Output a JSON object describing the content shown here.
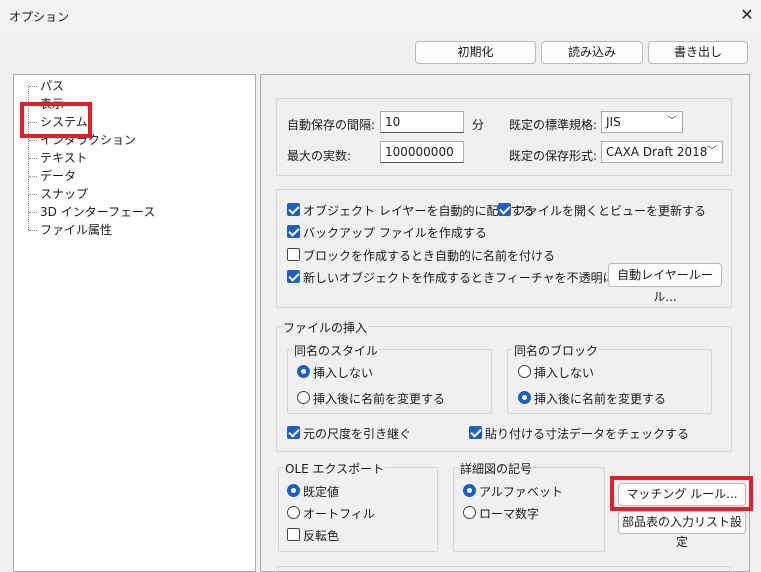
{
  "window": {
    "title": "オプション"
  },
  "toolbar": {
    "reset_label": "初期化",
    "load_label": "読み込み",
    "export_label": "書き出し"
  },
  "tree": {
    "items": [
      {
        "label": "パス"
      },
      {
        "label": "表示"
      },
      {
        "label": "システム"
      },
      {
        "label": "インタラクション"
      },
      {
        "label": "テキスト"
      },
      {
        "label": "データ"
      },
      {
        "label": "スナップ"
      },
      {
        "label": "3D インターフェース"
      },
      {
        "label": "ファイル属性"
      }
    ]
  },
  "autosave": {
    "interval_label": "自動保存の間隔:",
    "interval_value": "10",
    "interval_unit": "分",
    "standard_label": "既定の標準規格:",
    "standard_value": "JIS",
    "max_label": "最大の実数:",
    "max_value": "100000000",
    "format_label": "既定の保存形式:",
    "format_value": "CAXA Draft 2018"
  },
  "options": {
    "auto_layer_label": "オブジェクト レイヤーを自動的に配置する",
    "refresh_view_label": "ファイルを開くとビューを更新する",
    "backup_label": "バックアップ ファイルを作成する",
    "auto_name_label": "ブロックを作成するとき自動的に名前を付ける",
    "opaque_label": "新しいオブジェクトを作成するときフィーチャを不透明に設定する",
    "auto_layer_rule_label": "自動レイヤールール..."
  },
  "insert": {
    "title": "ファイルの挿入",
    "style_group": "同名のスタイル",
    "style_no_insert": "挿入しない",
    "style_rename": "挿入後に名前を変更する",
    "block_group": "同名のブロック",
    "block_no_insert": "挿入しない",
    "block_rename": "挿入後に名前を変更する",
    "keep_scale_label": "元の尺度を引き継ぐ",
    "check_dim_label": "貼り付ける寸法データをチェックする"
  },
  "ole": {
    "title": "OLE エクスポート",
    "default_label": "既定値",
    "autofill_label": "オートフィル",
    "invert_label": "反転色"
  },
  "detail": {
    "title": "詳細図の記号",
    "alpha_label": "アルファベット",
    "roman_label": "ローマ数字"
  },
  "buttons": {
    "matching_label": "マッチング ルール...",
    "bom_label": "部品表の入力リスト設定"
  },
  "colors": {
    "accent": "#1f5fbf",
    "highlight": "#e0202a"
  }
}
